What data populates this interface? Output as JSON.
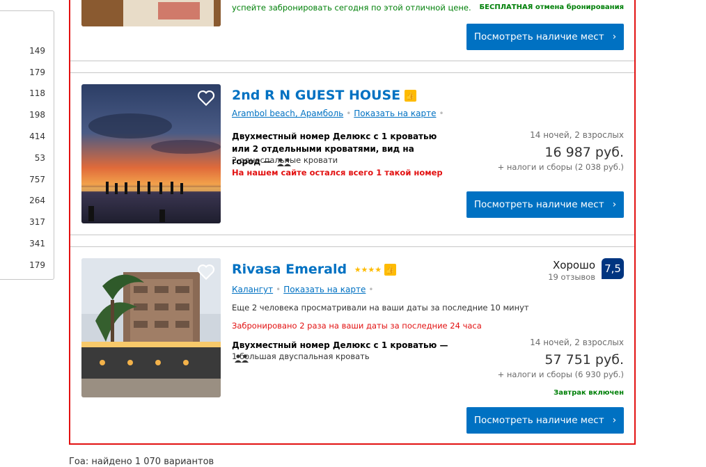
{
  "filter_counts": [
    "149",
    "179",
    "118",
    "198",
    "414",
    "53",
    "757",
    "264",
    "317",
    "341",
    "179"
  ],
  "card1": {
    "urgency_text": "успейте забронировать сегодня по этой отличной цене.",
    "free_cancel": "БЕСПЛАТНАЯ отмена бронирования",
    "button_label": "Посмотреть наличие мест"
  },
  "card2": {
    "name": "2nd R N GUEST HOUSE",
    "location": "Arambol beach, Арамболь",
    "map_link": "Показать на карте",
    "room_type": "Двухместный номер Делюкс с 1 кроватью или 2 отдельными кроватями, вид на город",
    "dash": "—",
    "beds": "2 односпальные кровати",
    "availability_warning": "На нашем сайте остался всего 1 такой номер",
    "nights": "14 ночей, 2 взрослых",
    "price": "16 987 руб.",
    "taxes": "+ налоги и сборы (2 038 руб.)",
    "button_label": "Посмотреть наличие мест"
  },
  "card3": {
    "name": "Rivasa Emerald",
    "stars": "★★★★",
    "location": "Калангут",
    "map_link": "Показать на карте",
    "score_word": "Хорошо",
    "reviews": "19 отзывов",
    "score": "7,5",
    "viewing_note": "Еще 2 человека просматривали на ваши даты за последние 10 минут",
    "booked_note": "Забронировано 2 раза на ваши даты за последние 24 часа",
    "room_type": "Двухместный номер Делюкс с 1 кроватью",
    "dash": "—",
    "beds": "1 большая двуспальная кровать",
    "nights": "14 ночей, 2 взрослых",
    "price": "57 751 руб.",
    "taxes": "+ налоги и сборы (6 930 руб.)",
    "breakfast": "Завтрак включен",
    "button_label": "Посмотреть наличие мест"
  },
  "footer_text": "Гоа: найдено 1 070 вариантов",
  "colors": {
    "accent": "#0071c2",
    "score_bg": "#003580",
    "highlight_border": "#e21111",
    "green": "#008009",
    "genius": "#febb02"
  }
}
